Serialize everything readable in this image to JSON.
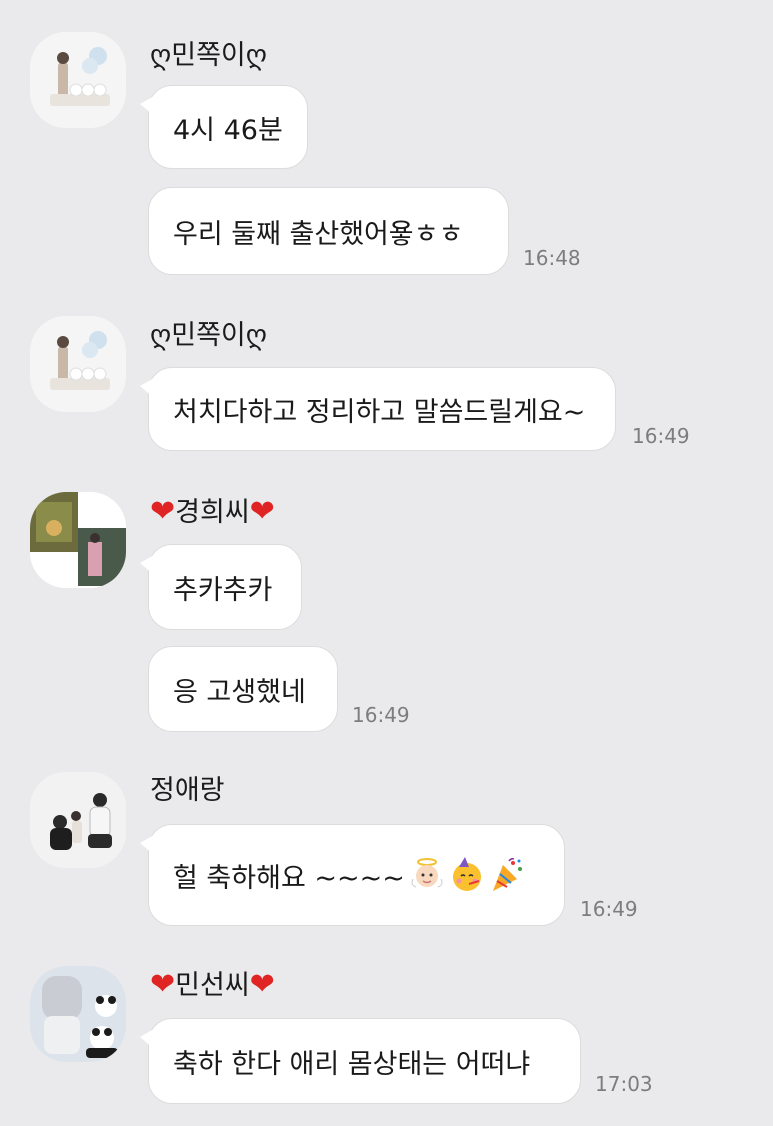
{
  "messages": [
    {
      "sender": "ღ민쪽이ღ",
      "bubbles": [
        "4시 46분",
        "우리 둘째 출산했어욯ㅎㅎ"
      ],
      "time": "16:48"
    },
    {
      "sender": "ღ민쪽이ღ",
      "bubbles": [
        "처치다하고 정리하고 말씀드릴게요~"
      ],
      "time": "16:49"
    },
    {
      "sender_heart_left": "❤",
      "sender": "경희씨",
      "sender_heart_right": "❤",
      "bubbles": [
        "추카추카",
        "응 고생했네"
      ],
      "time": "16:49"
    },
    {
      "sender": "정애랑",
      "bubbles": [
        "헐 축하해요 ~~~~"
      ],
      "emojis": [
        "angel-baby-emoji",
        "party-face-emoji",
        "party-popper-emoji"
      ],
      "time": "16:49"
    },
    {
      "sender_heart_left": "❤",
      "sender": "민선씨",
      "sender_heart_right": "❤",
      "bubbles": [
        "축하 한다  애리 몸상태는 어떠냐"
      ],
      "time": "17:03"
    }
  ],
  "colors": {
    "background": "#eaeaec",
    "bubble": "#ffffff",
    "time_text": "#7d7d7d",
    "heart": "#e02323"
  }
}
